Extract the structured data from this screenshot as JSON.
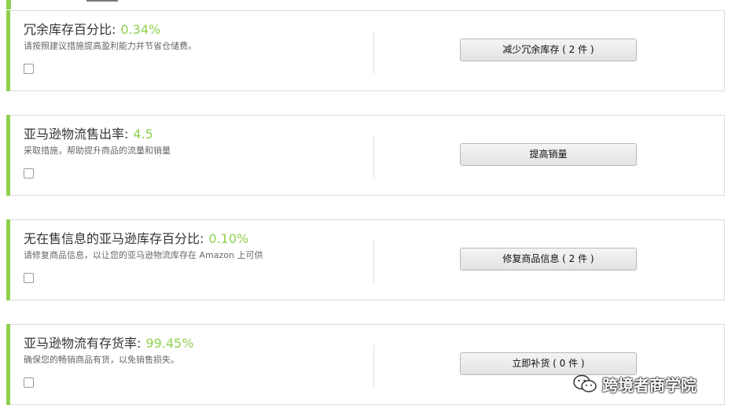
{
  "cards": [
    {
      "title": "冗余库存百分比:",
      "value": "0.34%",
      "desc": "请按照建议措施提高盈利能力并节省仓储费。",
      "button": "减少冗余库存 ( 2 件 )"
    },
    {
      "title": "亚马逊物流售出率:",
      "value": "4.5",
      "desc": "采取措施，帮助提升商品的流量和销量",
      "button": "提高销量"
    },
    {
      "title": "无在售信息的亚马逊库存百分比:",
      "value": "0.10%",
      "desc": "请修复商品信息，以让您的亚马逊物流库存在 Amazon 上可供",
      "button": "修复商品信息 ( 2 件 )"
    },
    {
      "title": "亚马逊物流有存货率:",
      "value": "99.45%",
      "desc": "确保您的畅销商品有货，以免销售损失。",
      "button": "立即补货 ( 0 件 )"
    }
  ],
  "watermark": {
    "text": "跨境者商学院",
    "icon": "wechat-icon"
  },
  "colors": {
    "accent": "#8fd14f",
    "value": "#8fd14f",
    "border": "#dcdcdc"
  }
}
